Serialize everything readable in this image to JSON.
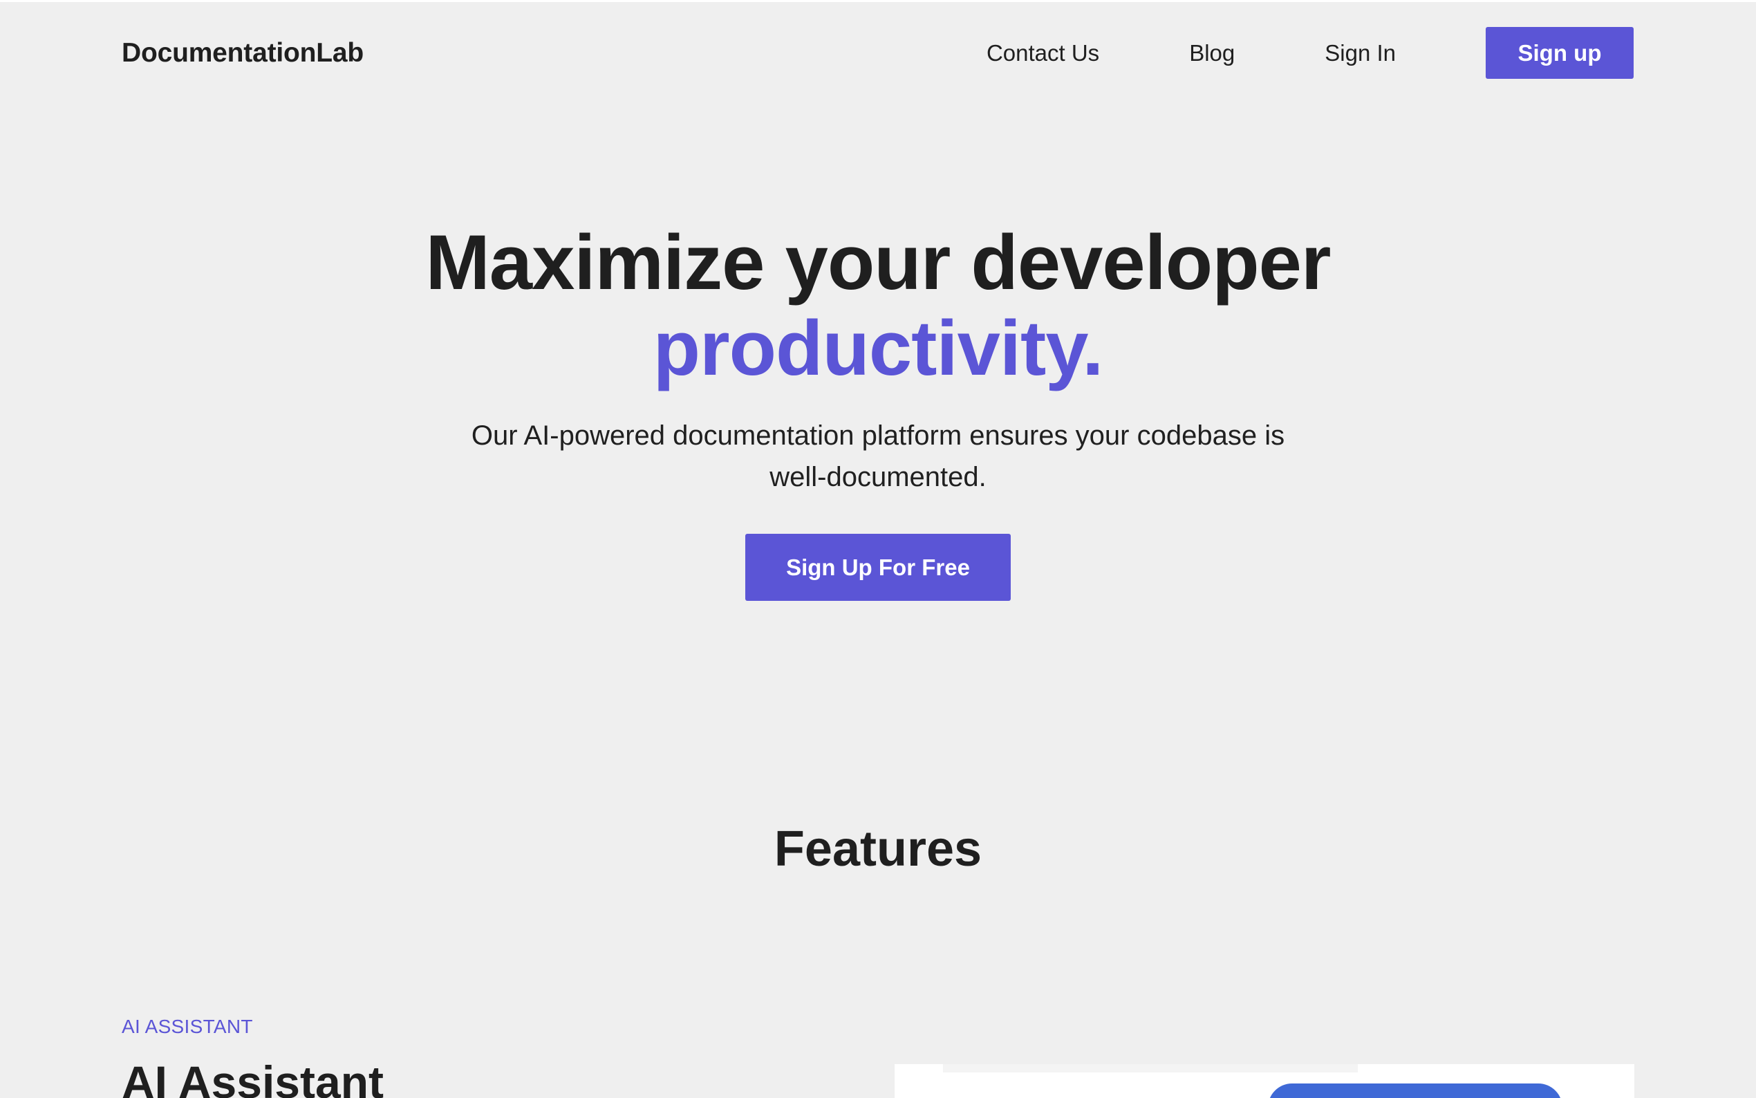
{
  "header": {
    "brand": "DocumentationLab",
    "nav": {
      "contact": "Contact Us",
      "blog": "Blog",
      "signin": "Sign In",
      "signup": "Sign up"
    }
  },
  "hero": {
    "title_line1": "Maximize your developer",
    "title_line2": "productivity.",
    "subtitle": "Our AI-powered documentation platform ensures your codebase is well-documented.",
    "cta": "Sign Up For Free"
  },
  "features": {
    "heading": "Features",
    "first": {
      "eyebrow": "AI ASSISTANT",
      "title": "AI Assistant"
    }
  },
  "colors": {
    "background": "#efefef",
    "accent": "#5b55d6",
    "text": "#1f1f1f",
    "preview_button": "#3f69d6"
  }
}
